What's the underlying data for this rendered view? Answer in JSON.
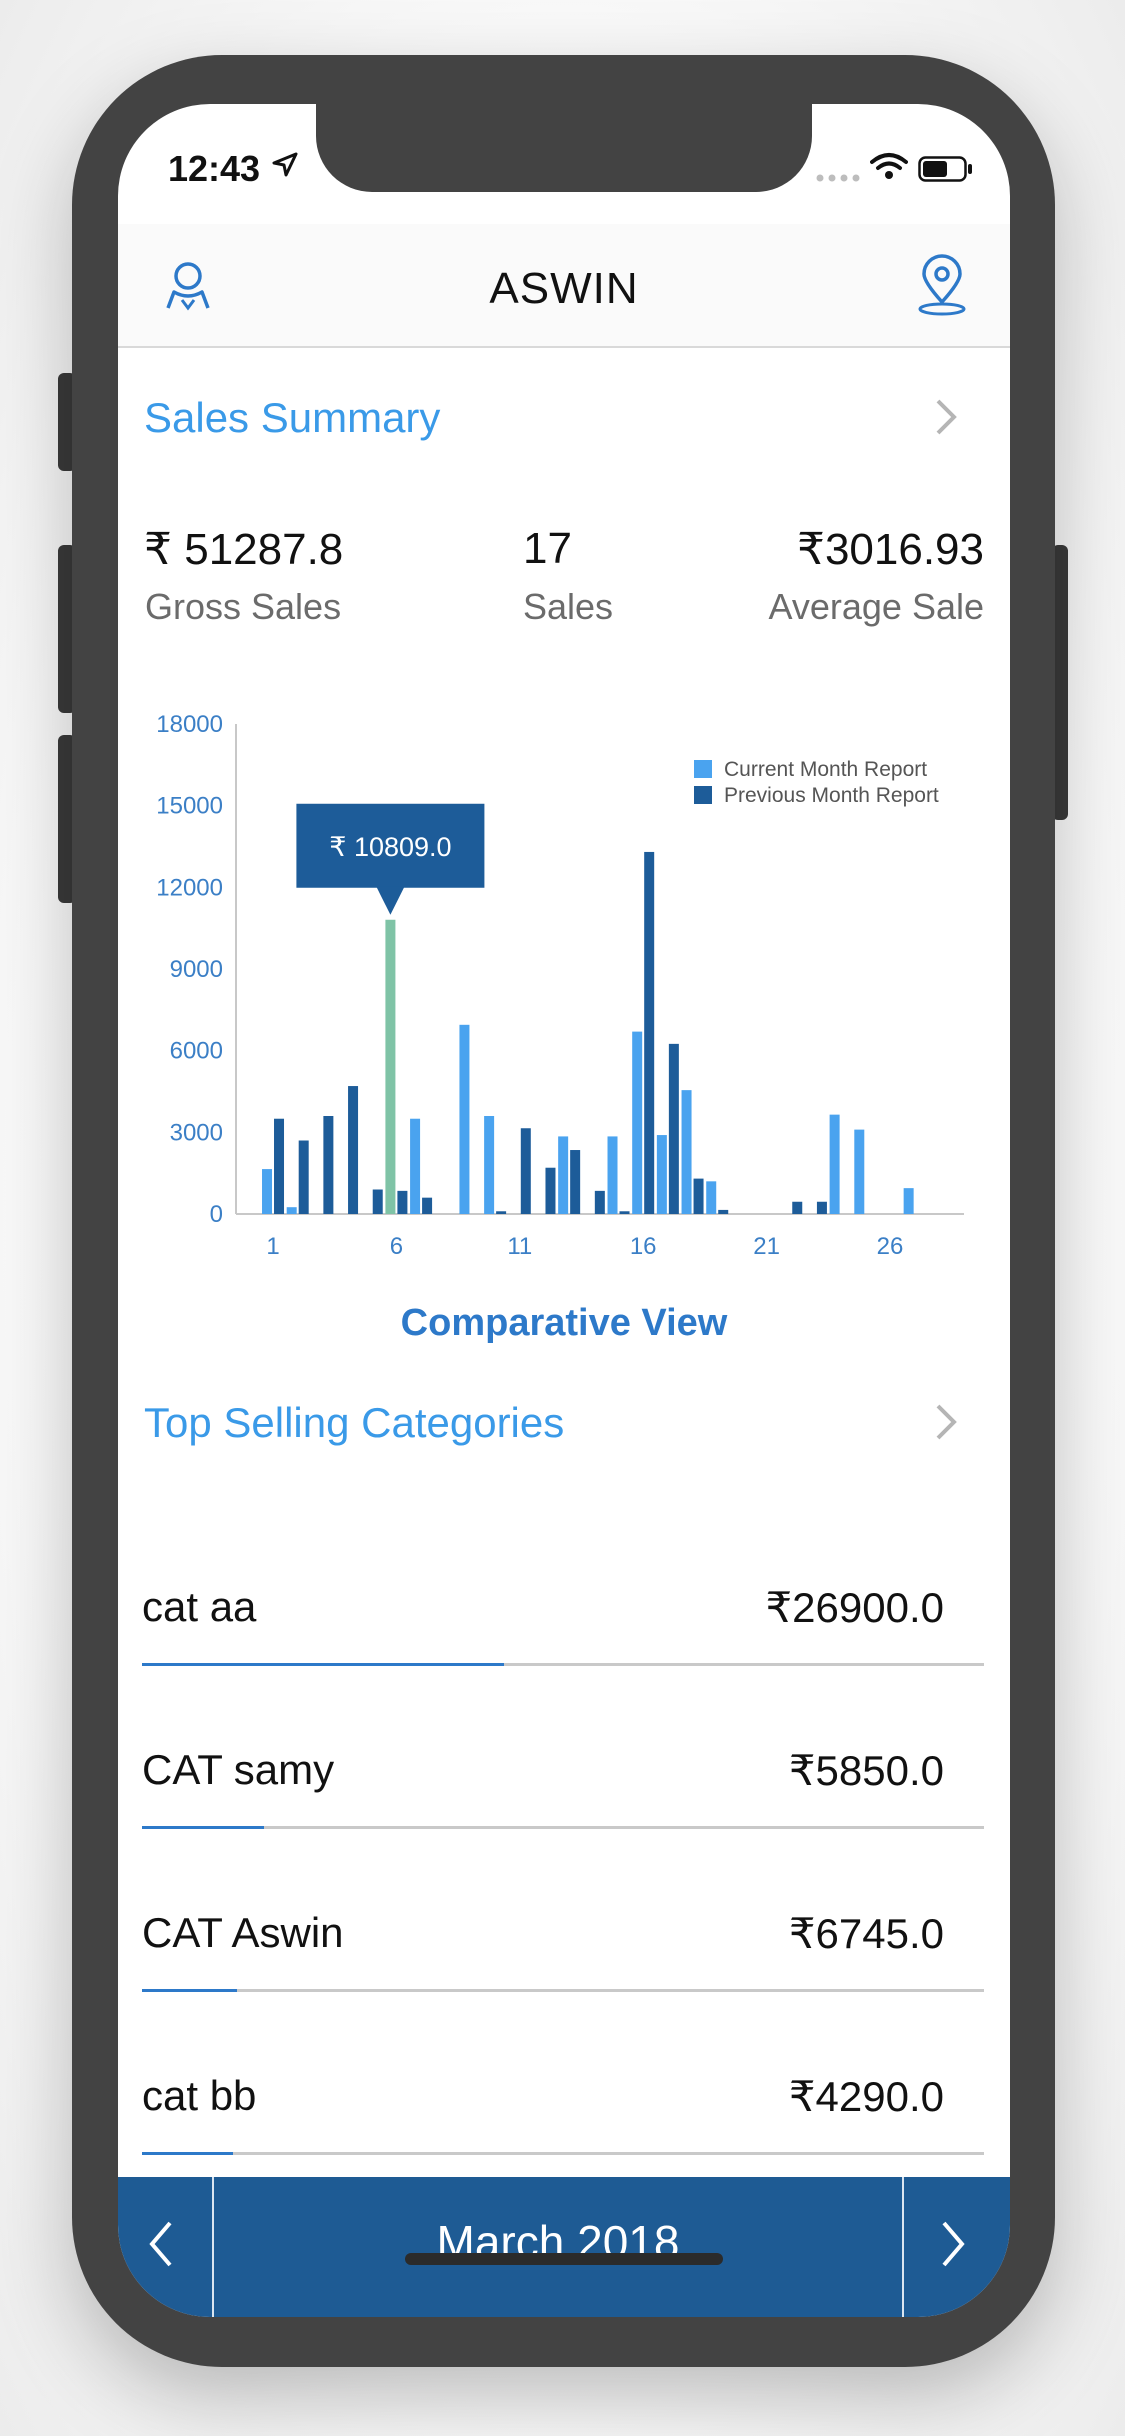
{
  "status_bar": {
    "time": "12:43"
  },
  "header": {
    "title": "ASWIN"
  },
  "sales_summary": {
    "title": "Sales Summary",
    "stats": [
      {
        "value": "₹ 51287.8",
        "label": "Gross Sales"
      },
      {
        "value": "17",
        "label": "Sales"
      },
      {
        "value": "₹3016.93",
        "label": "Average Sale"
      }
    ]
  },
  "chart_data": {
    "type": "bar",
    "title": "Comparative View",
    "x_ticks": [
      "1",
      "6",
      "11",
      "16",
      "21",
      "26"
    ],
    "y_ticks": [
      "0",
      "3000",
      "6000",
      "9000",
      "12000",
      "15000",
      "18000"
    ],
    "ylim": [
      0,
      18000
    ],
    "legend": "top-right",
    "tooltip": "₹ 10809.0",
    "colors": {
      "current": "#4aa3ef",
      "previous": "#1d5c99",
      "highlight": "#7fc3a6"
    },
    "series": [
      {
        "name": "Current Month Report",
        "points": [
          {
            "x": 1,
            "y": 1650
          },
          {
            "x": 2,
            "y": 250
          },
          {
            "x": 5,
            "y": 0
          },
          {
            "x": 6,
            "y": 10809
          },
          {
            "x": 7,
            "y": 3500
          },
          {
            "x": 9,
            "y": 6950
          },
          {
            "x": 10,
            "y": 3600
          },
          {
            "x": 13,
            "y": 2850
          },
          {
            "x": 15,
            "y": 2850
          },
          {
            "x": 16,
            "y": 6700
          },
          {
            "x": 17,
            "y": 2900
          },
          {
            "x": 18,
            "y": 4550
          },
          {
            "x": 19,
            "y": 1200
          },
          {
            "x": 24,
            "y": 3650
          },
          {
            "x": 25,
            "y": 3100
          },
          {
            "x": 27,
            "y": 950
          }
        ]
      },
      {
        "name": "Previous Month Report",
        "points": [
          {
            "x": 1,
            "y": 3500
          },
          {
            "x": 2,
            "y": 2700
          },
          {
            "x": 3,
            "y": 3600
          },
          {
            "x": 4,
            "y": 4700
          },
          {
            "x": 5,
            "y": 900
          },
          {
            "x": 6,
            "y": 850
          },
          {
            "x": 7,
            "y": 600
          },
          {
            "x": 10,
            "y": 100
          },
          {
            "x": 11,
            "y": 3150
          },
          {
            "x": 12,
            "y": 1700
          },
          {
            "x": 13,
            "y": 2350
          },
          {
            "x": 14,
            "y": 850
          },
          {
            "x": 15,
            "y": 100
          },
          {
            "x": 16,
            "y": 13300
          },
          {
            "x": 17,
            "y": 6250
          },
          {
            "x": 18,
            "y": 1300
          },
          {
            "x": 19,
            "y": 150
          },
          {
            "x": 22,
            "y": 450
          },
          {
            "x": 23,
            "y": 450
          }
        ]
      }
    ]
  },
  "top_categories": {
    "title": "Top Selling Categories",
    "items": [
      {
        "name": "cat aa",
        "value": "₹26900.0",
        "share": 0.43
      },
      {
        "name": "CAT samy",
        "value": "₹5850.0",
        "share": 0.145
      },
      {
        "name": "CAT Aswin",
        "value": "₹6745.0",
        "share": 0.113
      },
      {
        "name": "cat bb",
        "value": "₹4290.0",
        "share": 0.108
      }
    ]
  },
  "bottom_bar": {
    "month": "March 2018"
  }
}
